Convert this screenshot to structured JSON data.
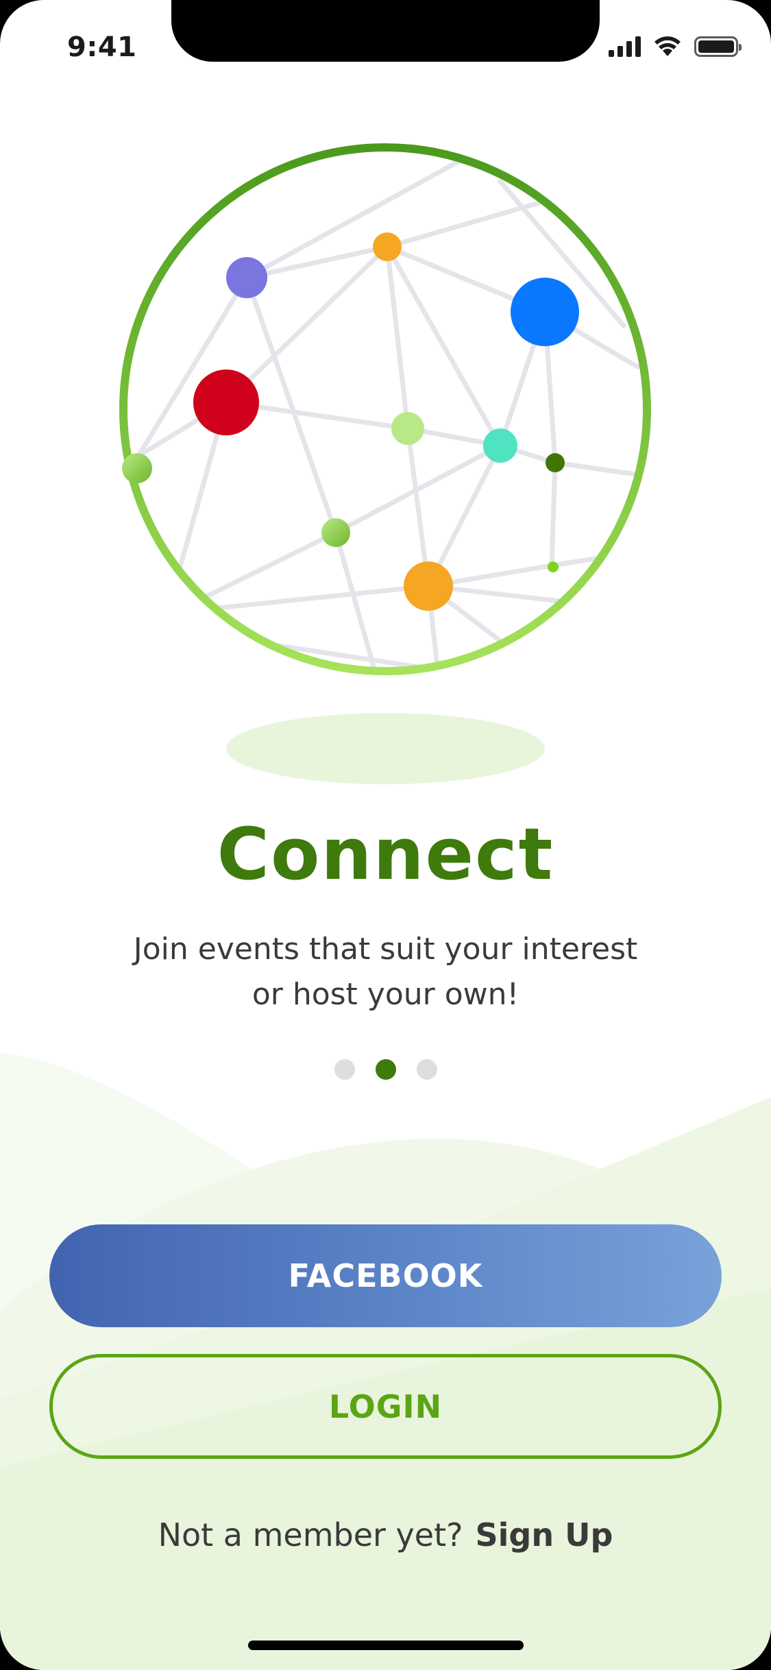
{
  "status_bar": {
    "time": "9:41",
    "icons": [
      "cellular-signal-icon",
      "wifi-icon",
      "battery-icon"
    ]
  },
  "illustration": {
    "icon": "network-globe-illustration",
    "ring_colors": [
      "#4a9a1c",
      "#a6e35a"
    ],
    "node_colors": [
      "#7b75e0",
      "#f5a623",
      "#0a78ff",
      "#d0021b",
      "#b8e986",
      "#50e3c2",
      "#417505",
      "#8bcc3a"
    ]
  },
  "onboarding": {
    "title": "Connect",
    "subtitle_line1": "Join events that suit your interest",
    "subtitle_line2": "or host your own!",
    "page_indicator": {
      "count": 3,
      "active_index": 1
    }
  },
  "buttons": {
    "facebook_label": "FACEBOOK",
    "login_label": "LOGIN"
  },
  "signup": {
    "prompt": "Not a member yet?",
    "link_label": "Sign Up"
  },
  "colors": {
    "brand_green": "#3e7a0c",
    "login_green": "#5ba514",
    "facebook_blue": "#4264b0",
    "dot_inactive": "#dedede"
  }
}
